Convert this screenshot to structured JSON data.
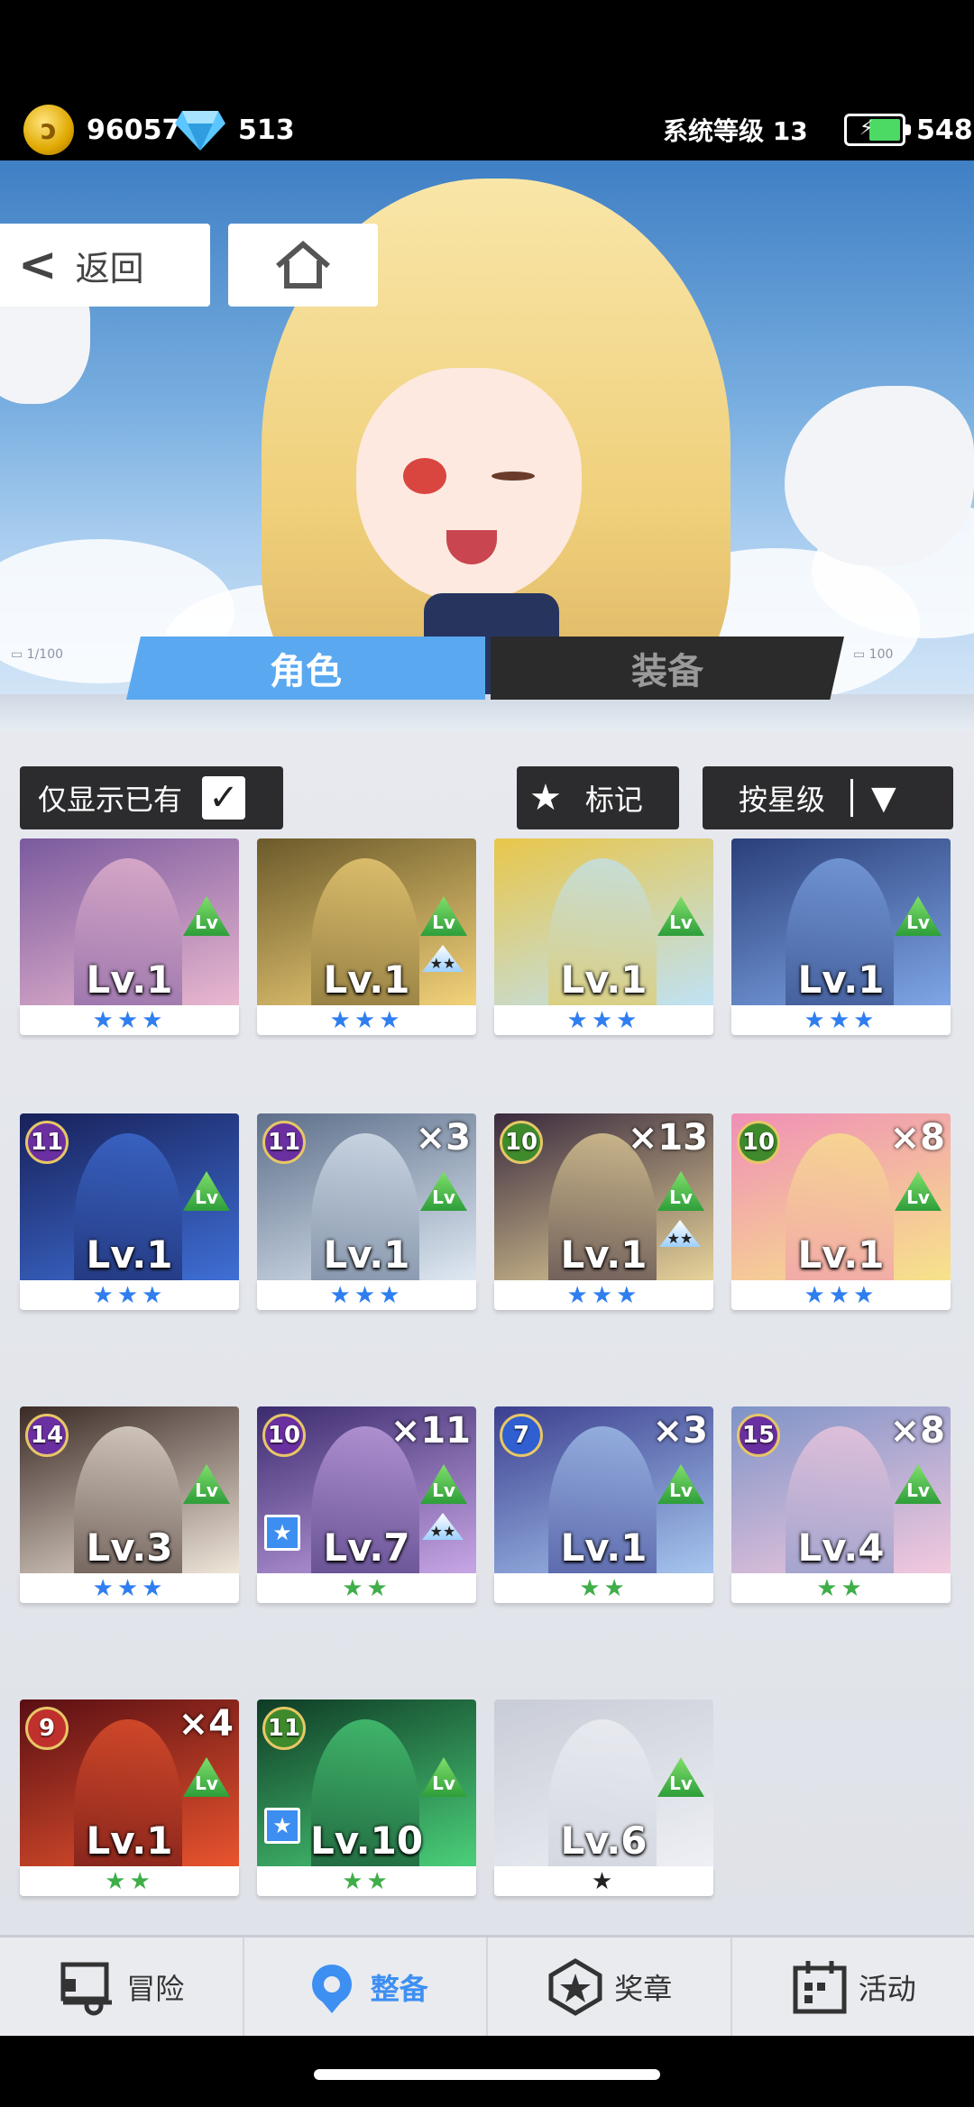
{
  "status": {
    "coins": "96057",
    "gems": "513",
    "system_level": "系统等级 13",
    "battery": "548",
    "colors": {
      "coin": "#e0a800",
      "gem": "#5bc6ff",
      "battery": "#4cd964"
    }
  },
  "header": {
    "back_label": "返回",
    "home_icon": "home-icon"
  },
  "tabs": [
    {
      "label": "角色",
      "active": true
    },
    {
      "label": "装备",
      "active": false
    }
  ],
  "filters": {
    "owned_only_label": "仅显示已有",
    "owned_only_checked": true,
    "mark_label": "标记",
    "sort_label": "按星级"
  },
  "cards": [
    {
      "level": "",
      "dup": "",
      "lv": "Lv.1",
      "stars": 3,
      "star_color": "blue",
      "star_up": false,
      "pinned": false,
      "palette": [
        "#7a5a9e",
        "#e9b7cf"
      ]
    },
    {
      "level": "",
      "dup": "",
      "lv": "Lv.1",
      "stars": 3,
      "star_color": "blue",
      "star_up": true,
      "pinned": false,
      "palette": [
        "#6b5a2a",
        "#f3d27a"
      ]
    },
    {
      "level": "",
      "dup": "",
      "lv": "Lv.1",
      "stars": 3,
      "star_color": "blue",
      "star_up": false,
      "pinned": false,
      "palette": [
        "#e8c64a",
        "#bfe2f5"
      ]
    },
    {
      "level": "",
      "dup": "",
      "lv": "Lv.1",
      "stars": 3,
      "star_color": "blue",
      "star_up": false,
      "pinned": false,
      "palette": [
        "#2a3f7a",
        "#7fa6e6"
      ]
    },
    {
      "level": "11",
      "dup": "",
      "lv": "Lv.1",
      "stars": 3,
      "star_color": "blue",
      "star_up": false,
      "pinned": false,
      "badge_color": "#6a2fa0",
      "palette": [
        "#18215a",
        "#3f6fd6"
      ]
    },
    {
      "level": "11",
      "dup": "×3",
      "lv": "Lv.1",
      "stars": 3,
      "star_color": "blue",
      "star_up": false,
      "pinned": false,
      "badge_color": "#6a2fa0",
      "palette": [
        "#5d6f8a",
        "#dfe9f3"
      ]
    },
    {
      "level": "10",
      "dup": "×13",
      "lv": "Lv.1",
      "stars": 3,
      "star_color": "blue",
      "star_up": true,
      "pinned": false,
      "badge_color": "#3f8a2c",
      "palette": [
        "#3a2a3e",
        "#e7d39a"
      ]
    },
    {
      "level": "10",
      "dup": "×8",
      "lv": "Lv.1",
      "stars": 3,
      "star_color": "blue",
      "star_up": false,
      "pinned": false,
      "badge_color": "#3f8a2c",
      "palette": [
        "#f08fb7",
        "#f7e38a"
      ]
    },
    {
      "level": "14",
      "dup": "",
      "lv": "Lv.3",
      "stars": 3,
      "star_color": "blue",
      "star_up": false,
      "pinned": false,
      "badge_color": "#6a2fa0",
      "palette": [
        "#3b2a25",
        "#f0e6da"
      ]
    },
    {
      "level": "10",
      "dup": "×11",
      "lv": "Lv.7",
      "stars": 2,
      "star_color": "green",
      "star_up": true,
      "pinned": true,
      "badge_color": "#6a2fa0",
      "palette": [
        "#3a2b6e",
        "#c8a6e6"
      ]
    },
    {
      "level": "7",
      "dup": "×3",
      "lv": "Lv.1",
      "stars": 2,
      "star_color": "green",
      "star_up": false,
      "pinned": false,
      "badge_color": "#2f5fd0",
      "palette": [
        "#3b3f8f",
        "#a7c6ef"
      ]
    },
    {
      "level": "15",
      "dup": "×8",
      "lv": "Lv.4",
      "stars": 2,
      "star_color": "green",
      "star_up": false,
      "pinned": false,
      "badge_color": "#6a2fa0",
      "palette": [
        "#7e93c7",
        "#f3c9de"
      ]
    },
    {
      "level": "9",
      "dup": "×4",
      "lv": "Lv.1",
      "stars": 2,
      "star_color": "green",
      "star_up": false,
      "pinned": false,
      "badge_color": "#c0302c",
      "palette": [
        "#5a0f14",
        "#e9542e"
      ]
    },
    {
      "level": "11",
      "dup": "",
      "lv": "Lv.10",
      "stars": 2,
      "star_color": "green",
      "star_up": false,
      "pinned": true,
      "badge_color": "#3f8a2c",
      "palette": [
        "#0e3b25",
        "#4bd07a"
      ]
    },
    {
      "level": "",
      "dup": "",
      "lv": "Lv.6",
      "stars": 1,
      "star_color": "black",
      "star_up": false,
      "pinned": false,
      "palette": [
        "#c8ccd6",
        "#eef0f5"
      ]
    }
  ],
  "nav": [
    {
      "label": "冒险",
      "icon": "truck-icon",
      "active": false
    },
    {
      "label": "整备",
      "icon": "gear-heart-icon",
      "active": true
    },
    {
      "label": "奖章",
      "icon": "medal-icon",
      "active": false
    },
    {
      "label": "活动",
      "icon": "calendar-icon",
      "active": false
    }
  ],
  "lv_badge_text": "Lv"
}
